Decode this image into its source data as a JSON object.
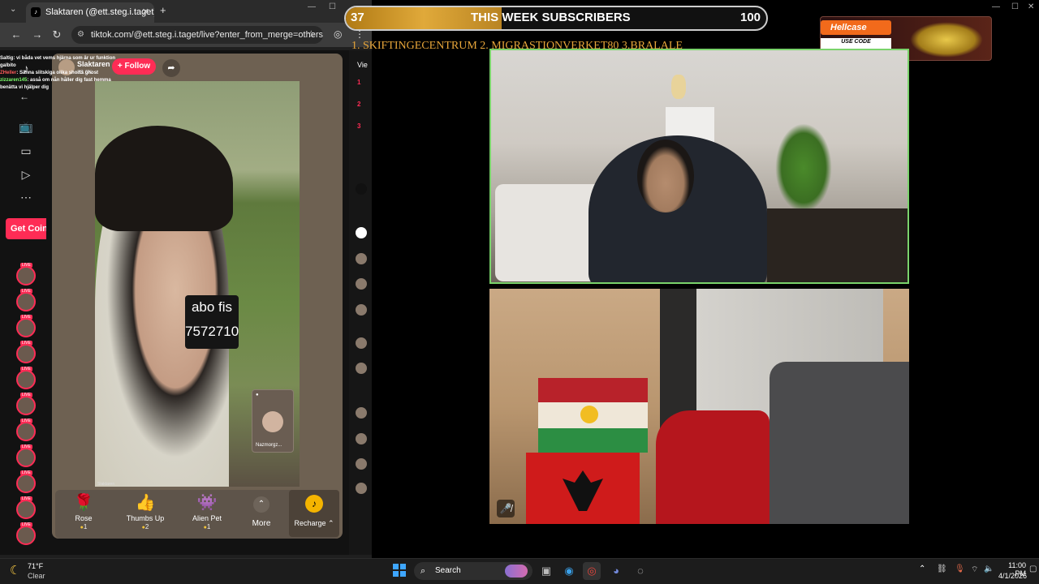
{
  "browser": {
    "tab_title": "Slaktaren (@ett.steg.i.taget)",
    "tab_close": "✕",
    "new_tab": "+",
    "url": "tiktok.com/@ett.steg.i.taget/live?enter_from_merge=others_...",
    "nav": {
      "back": "←",
      "forward": "→",
      "reload": "↻"
    }
  },
  "tiktok": {
    "host_name": "Slaktaren",
    "host_followers": "33.6K",
    "follow_label": "+ Follow",
    "get_coins_label": "Get Coins",
    "caption_line1": "abo fis",
    "caption_line2": "7572710",
    "guest_name": "Nazmorgz...",
    "watermark": "Slaktaren",
    "chat": [
      {
        "user": "Saltig",
        "text": ": vi båda vet vems hjärna som är ur funktion",
        "color": "white"
      },
      {
        "user": "",
        "text": "galbito",
        "color": "white"
      },
      {
        "user": "ZHeller",
        "text": ": Sänna slitskiga olika shorts ghost",
        "color": "red"
      },
      {
        "user": "zizzaren145",
        "text": ": asså om nån håller dig fast hemma",
        "color": "green"
      },
      {
        "user": "",
        "text": "benätta vi hjälper dig",
        "color": "white"
      }
    ],
    "gifts": [
      {
        "name": "Rose",
        "icon": "🌹",
        "cost": "1"
      },
      {
        "name": "Thumbs Up",
        "icon": "👍",
        "cost": "2"
      },
      {
        "name": "Alien Pet",
        "icon": "👾",
        "cost": "1"
      }
    ],
    "more_label": "More",
    "recharge_label": "Recharge",
    "right_title": "Vie",
    "ranks": [
      "1",
      "2",
      "3"
    ]
  },
  "overlay": {
    "sub_count": "37",
    "sub_title": "THIS WEEK SUBSCRIBERS",
    "sub_goal": "100",
    "sub_progress": 0.37,
    "ticker": "1. SKIFTINGECENTRUM  2. MIGRASTIONVERKET80 3.BRALALE"
  },
  "hellcase": {
    "brand": "Hellcase",
    "use_code": "USE CODE",
    "code": "ghostalby"
  },
  "taskbar": {
    "temp": "71°F",
    "weather": "Clear",
    "search": "Search",
    "time": "11:00 PM",
    "date": "4/1/2026"
  },
  "colors": {
    "tiktok_red": "#fe2c55",
    "cam_border": "#7ad36b",
    "ticker": "#e8a63a"
  }
}
